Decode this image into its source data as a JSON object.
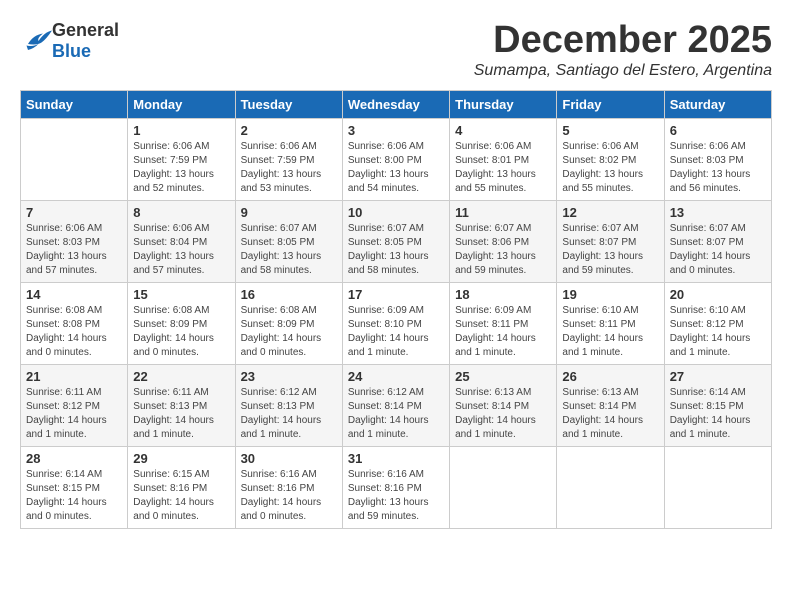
{
  "logo": {
    "general": "General",
    "blue": "Blue"
  },
  "title": "December 2025",
  "subtitle": "Sumampa, Santiago del Estero, Argentina",
  "days_of_week": [
    "Sunday",
    "Monday",
    "Tuesday",
    "Wednesday",
    "Thursday",
    "Friday",
    "Saturday"
  ],
  "weeks": [
    [
      {
        "day": "",
        "info": ""
      },
      {
        "day": "1",
        "info": "Sunrise: 6:06 AM\nSunset: 7:59 PM\nDaylight: 13 hours and 52 minutes."
      },
      {
        "day": "2",
        "info": "Sunrise: 6:06 AM\nSunset: 7:59 PM\nDaylight: 13 hours and 53 minutes."
      },
      {
        "day": "3",
        "info": "Sunrise: 6:06 AM\nSunset: 8:00 PM\nDaylight: 13 hours and 54 minutes."
      },
      {
        "day": "4",
        "info": "Sunrise: 6:06 AM\nSunset: 8:01 PM\nDaylight: 13 hours and 55 minutes."
      },
      {
        "day": "5",
        "info": "Sunrise: 6:06 AM\nSunset: 8:02 PM\nDaylight: 13 hours and 55 minutes."
      },
      {
        "day": "6",
        "info": "Sunrise: 6:06 AM\nSunset: 8:03 PM\nDaylight: 13 hours and 56 minutes."
      }
    ],
    [
      {
        "day": "7",
        "info": "Sunrise: 6:06 AM\nSunset: 8:03 PM\nDaylight: 13 hours and 57 minutes."
      },
      {
        "day": "8",
        "info": "Sunrise: 6:06 AM\nSunset: 8:04 PM\nDaylight: 13 hours and 57 minutes."
      },
      {
        "day": "9",
        "info": "Sunrise: 6:07 AM\nSunset: 8:05 PM\nDaylight: 13 hours and 58 minutes."
      },
      {
        "day": "10",
        "info": "Sunrise: 6:07 AM\nSunset: 8:05 PM\nDaylight: 13 hours and 58 minutes."
      },
      {
        "day": "11",
        "info": "Sunrise: 6:07 AM\nSunset: 8:06 PM\nDaylight: 13 hours and 59 minutes."
      },
      {
        "day": "12",
        "info": "Sunrise: 6:07 AM\nSunset: 8:07 PM\nDaylight: 13 hours and 59 minutes."
      },
      {
        "day": "13",
        "info": "Sunrise: 6:07 AM\nSunset: 8:07 PM\nDaylight: 14 hours and 0 minutes."
      }
    ],
    [
      {
        "day": "14",
        "info": "Sunrise: 6:08 AM\nSunset: 8:08 PM\nDaylight: 14 hours and 0 minutes."
      },
      {
        "day": "15",
        "info": "Sunrise: 6:08 AM\nSunset: 8:09 PM\nDaylight: 14 hours and 0 minutes."
      },
      {
        "day": "16",
        "info": "Sunrise: 6:08 AM\nSunset: 8:09 PM\nDaylight: 14 hours and 0 minutes."
      },
      {
        "day": "17",
        "info": "Sunrise: 6:09 AM\nSunset: 8:10 PM\nDaylight: 14 hours and 1 minute."
      },
      {
        "day": "18",
        "info": "Sunrise: 6:09 AM\nSunset: 8:11 PM\nDaylight: 14 hours and 1 minute."
      },
      {
        "day": "19",
        "info": "Sunrise: 6:10 AM\nSunset: 8:11 PM\nDaylight: 14 hours and 1 minute."
      },
      {
        "day": "20",
        "info": "Sunrise: 6:10 AM\nSunset: 8:12 PM\nDaylight: 14 hours and 1 minute."
      }
    ],
    [
      {
        "day": "21",
        "info": "Sunrise: 6:11 AM\nSunset: 8:12 PM\nDaylight: 14 hours and 1 minute."
      },
      {
        "day": "22",
        "info": "Sunrise: 6:11 AM\nSunset: 8:13 PM\nDaylight: 14 hours and 1 minute."
      },
      {
        "day": "23",
        "info": "Sunrise: 6:12 AM\nSunset: 8:13 PM\nDaylight: 14 hours and 1 minute."
      },
      {
        "day": "24",
        "info": "Sunrise: 6:12 AM\nSunset: 8:14 PM\nDaylight: 14 hours and 1 minute."
      },
      {
        "day": "25",
        "info": "Sunrise: 6:13 AM\nSunset: 8:14 PM\nDaylight: 14 hours and 1 minute."
      },
      {
        "day": "26",
        "info": "Sunrise: 6:13 AM\nSunset: 8:14 PM\nDaylight: 14 hours and 1 minute."
      },
      {
        "day": "27",
        "info": "Sunrise: 6:14 AM\nSunset: 8:15 PM\nDaylight: 14 hours and 1 minute."
      }
    ],
    [
      {
        "day": "28",
        "info": "Sunrise: 6:14 AM\nSunset: 8:15 PM\nDaylight: 14 hours and 0 minutes."
      },
      {
        "day": "29",
        "info": "Sunrise: 6:15 AM\nSunset: 8:16 PM\nDaylight: 14 hours and 0 minutes."
      },
      {
        "day": "30",
        "info": "Sunrise: 6:16 AM\nSunset: 8:16 PM\nDaylight: 14 hours and 0 minutes."
      },
      {
        "day": "31",
        "info": "Sunrise: 6:16 AM\nSunset: 8:16 PM\nDaylight: 13 hours and 59 minutes."
      },
      {
        "day": "",
        "info": ""
      },
      {
        "day": "",
        "info": ""
      },
      {
        "day": "",
        "info": ""
      }
    ]
  ]
}
